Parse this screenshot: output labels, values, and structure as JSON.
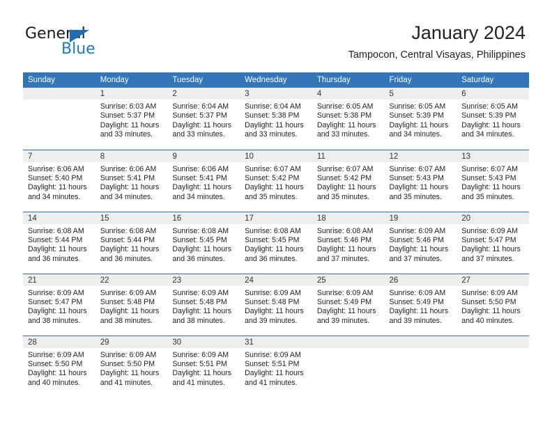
{
  "brand": {
    "name_part1": "General",
    "name_part2": "Blue",
    "logo_icon": "triangle-flag-icon"
  },
  "header": {
    "month_title": "January 2024",
    "location": "Tampocon, Central Visayas, Philippines"
  },
  "colors": {
    "header_blue": "#3275b8",
    "row_separator_blue": "#2f6fae",
    "daynum_band_gray": "#eeeeee",
    "brand_blue": "#1f7ac0",
    "text": "#222222"
  },
  "weekday_headers": [
    "Sunday",
    "Monday",
    "Tuesday",
    "Wednesday",
    "Thursday",
    "Friday",
    "Saturday"
  ],
  "labels": {
    "sunrise_prefix": "Sunrise:",
    "sunset_prefix": "Sunset:",
    "daylight_prefix": "Daylight:"
  },
  "weeks": [
    [
      {
        "day": "",
        "empty": true
      },
      {
        "day": "1",
        "sunrise": "Sunrise: 6:03 AM",
        "sunset": "Sunset: 5:37 PM",
        "daylight_line1": "Daylight: 11 hours",
        "daylight_line2": "and 33 minutes."
      },
      {
        "day": "2",
        "sunrise": "Sunrise: 6:04 AM",
        "sunset": "Sunset: 5:37 PM",
        "daylight_line1": "Daylight: 11 hours",
        "daylight_line2": "and 33 minutes."
      },
      {
        "day": "3",
        "sunrise": "Sunrise: 6:04 AM",
        "sunset": "Sunset: 5:38 PM",
        "daylight_line1": "Daylight: 11 hours",
        "daylight_line2": "and 33 minutes."
      },
      {
        "day": "4",
        "sunrise": "Sunrise: 6:05 AM",
        "sunset": "Sunset: 5:38 PM",
        "daylight_line1": "Daylight: 11 hours",
        "daylight_line2": "and 33 minutes."
      },
      {
        "day": "5",
        "sunrise": "Sunrise: 6:05 AM",
        "sunset": "Sunset: 5:39 PM",
        "daylight_line1": "Daylight: 11 hours",
        "daylight_line2": "and 34 minutes."
      },
      {
        "day": "6",
        "sunrise": "Sunrise: 6:05 AM",
        "sunset": "Sunset: 5:39 PM",
        "daylight_line1": "Daylight: 11 hours",
        "daylight_line2": "and 34 minutes."
      }
    ],
    [
      {
        "day": "7",
        "sunrise": "Sunrise: 6:06 AM",
        "sunset": "Sunset: 5:40 PM",
        "daylight_line1": "Daylight: 11 hours",
        "daylight_line2": "and 34 minutes."
      },
      {
        "day": "8",
        "sunrise": "Sunrise: 6:06 AM",
        "sunset": "Sunset: 5:41 PM",
        "daylight_line1": "Daylight: 11 hours",
        "daylight_line2": "and 34 minutes."
      },
      {
        "day": "9",
        "sunrise": "Sunrise: 6:06 AM",
        "sunset": "Sunset: 5:41 PM",
        "daylight_line1": "Daylight: 11 hours",
        "daylight_line2": "and 34 minutes."
      },
      {
        "day": "10",
        "sunrise": "Sunrise: 6:07 AM",
        "sunset": "Sunset: 5:42 PM",
        "daylight_line1": "Daylight: 11 hours",
        "daylight_line2": "and 35 minutes."
      },
      {
        "day": "11",
        "sunrise": "Sunrise: 6:07 AM",
        "sunset": "Sunset: 5:42 PM",
        "daylight_line1": "Daylight: 11 hours",
        "daylight_line2": "and 35 minutes."
      },
      {
        "day": "12",
        "sunrise": "Sunrise: 6:07 AM",
        "sunset": "Sunset: 5:43 PM",
        "daylight_line1": "Daylight: 11 hours",
        "daylight_line2": "and 35 minutes."
      },
      {
        "day": "13",
        "sunrise": "Sunrise: 6:07 AM",
        "sunset": "Sunset: 5:43 PM",
        "daylight_line1": "Daylight: 11 hours",
        "daylight_line2": "and 35 minutes."
      }
    ],
    [
      {
        "day": "14",
        "sunrise": "Sunrise: 6:08 AM",
        "sunset": "Sunset: 5:44 PM",
        "daylight_line1": "Daylight: 11 hours",
        "daylight_line2": "and 36 minutes."
      },
      {
        "day": "15",
        "sunrise": "Sunrise: 6:08 AM",
        "sunset": "Sunset: 5:44 PM",
        "daylight_line1": "Daylight: 11 hours",
        "daylight_line2": "and 36 minutes."
      },
      {
        "day": "16",
        "sunrise": "Sunrise: 6:08 AM",
        "sunset": "Sunset: 5:45 PM",
        "daylight_line1": "Daylight: 11 hours",
        "daylight_line2": "and 36 minutes."
      },
      {
        "day": "17",
        "sunrise": "Sunrise: 6:08 AM",
        "sunset": "Sunset: 5:45 PM",
        "daylight_line1": "Daylight: 11 hours",
        "daylight_line2": "and 36 minutes."
      },
      {
        "day": "18",
        "sunrise": "Sunrise: 6:08 AM",
        "sunset": "Sunset: 5:46 PM",
        "daylight_line1": "Daylight: 11 hours",
        "daylight_line2": "and 37 minutes."
      },
      {
        "day": "19",
        "sunrise": "Sunrise: 6:09 AM",
        "sunset": "Sunset: 5:46 PM",
        "daylight_line1": "Daylight: 11 hours",
        "daylight_line2": "and 37 minutes."
      },
      {
        "day": "20",
        "sunrise": "Sunrise: 6:09 AM",
        "sunset": "Sunset: 5:47 PM",
        "daylight_line1": "Daylight: 11 hours",
        "daylight_line2": "and 37 minutes."
      }
    ],
    [
      {
        "day": "21",
        "sunrise": "Sunrise: 6:09 AM",
        "sunset": "Sunset: 5:47 PM",
        "daylight_line1": "Daylight: 11 hours",
        "daylight_line2": "and 38 minutes."
      },
      {
        "day": "22",
        "sunrise": "Sunrise: 6:09 AM",
        "sunset": "Sunset: 5:48 PM",
        "daylight_line1": "Daylight: 11 hours",
        "daylight_line2": "and 38 minutes."
      },
      {
        "day": "23",
        "sunrise": "Sunrise: 6:09 AM",
        "sunset": "Sunset: 5:48 PM",
        "daylight_line1": "Daylight: 11 hours",
        "daylight_line2": "and 38 minutes."
      },
      {
        "day": "24",
        "sunrise": "Sunrise: 6:09 AM",
        "sunset": "Sunset: 5:48 PM",
        "daylight_line1": "Daylight: 11 hours",
        "daylight_line2": "and 39 minutes."
      },
      {
        "day": "25",
        "sunrise": "Sunrise: 6:09 AM",
        "sunset": "Sunset: 5:49 PM",
        "daylight_line1": "Daylight: 11 hours",
        "daylight_line2": "and 39 minutes."
      },
      {
        "day": "26",
        "sunrise": "Sunrise: 6:09 AM",
        "sunset": "Sunset: 5:49 PM",
        "daylight_line1": "Daylight: 11 hours",
        "daylight_line2": "and 39 minutes."
      },
      {
        "day": "27",
        "sunrise": "Sunrise: 6:09 AM",
        "sunset": "Sunset: 5:50 PM",
        "daylight_line1": "Daylight: 11 hours",
        "daylight_line2": "and 40 minutes."
      }
    ],
    [
      {
        "day": "28",
        "sunrise": "Sunrise: 6:09 AM",
        "sunset": "Sunset: 5:50 PM",
        "daylight_line1": "Daylight: 11 hours",
        "daylight_line2": "and 40 minutes."
      },
      {
        "day": "29",
        "sunrise": "Sunrise: 6:09 AM",
        "sunset": "Sunset: 5:50 PM",
        "daylight_line1": "Daylight: 11 hours",
        "daylight_line2": "and 41 minutes."
      },
      {
        "day": "30",
        "sunrise": "Sunrise: 6:09 AM",
        "sunset": "Sunset: 5:51 PM",
        "daylight_line1": "Daylight: 11 hours",
        "daylight_line2": "and 41 minutes."
      },
      {
        "day": "31",
        "sunrise": "Sunrise: 6:09 AM",
        "sunset": "Sunset: 5:51 PM",
        "daylight_line1": "Daylight: 11 hours",
        "daylight_line2": "and 41 minutes."
      },
      {
        "day": "",
        "empty": true
      },
      {
        "day": "",
        "empty": true
      },
      {
        "day": "",
        "empty": true
      }
    ]
  ]
}
